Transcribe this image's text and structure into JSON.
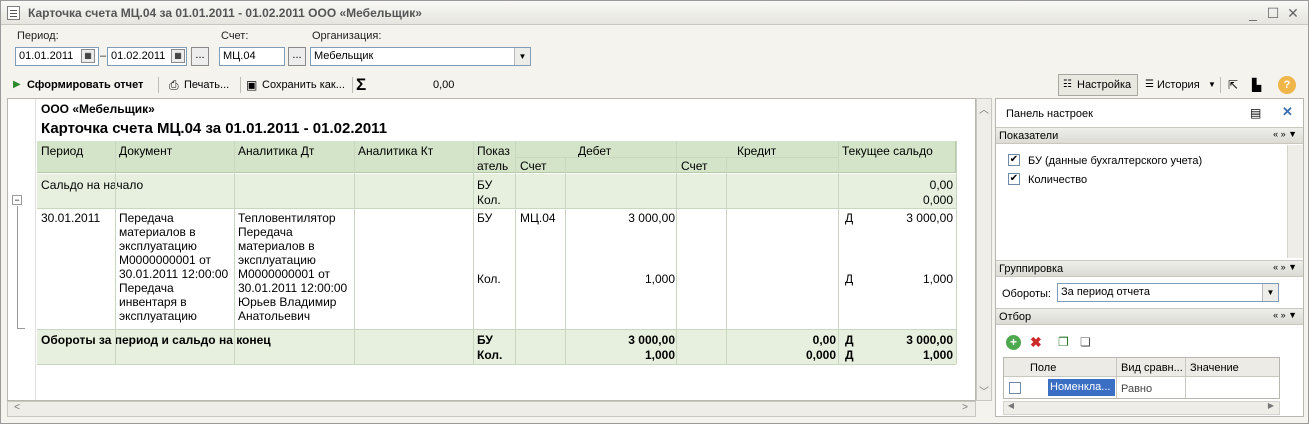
{
  "window": {
    "title": "Карточка счета МЦ.04 за 01.01.2011 - 01.02.2011 ООО «Мебельщик»"
  },
  "filters": {
    "period_label": "Период:",
    "date_from": "01.01.2011",
    "date_sep": "–",
    "date_to": "01.02.2011",
    "dots": "...",
    "account_label": "Счет:",
    "account": "МЦ.04",
    "org_label": "Организация:",
    "org": "Мебельщик"
  },
  "toolbar": {
    "generate": "Сформировать отчет",
    "print": "Печать...",
    "save": "Сохранить как...",
    "sigma": "Σ",
    "sum_value": "0,00",
    "settings": "Настройка",
    "history": "История"
  },
  "report": {
    "org": "ООО «Мебельщик»",
    "title": "Карточка счета МЦ.04 за 01.01.2011 - 01.02.2011",
    "headers": {
      "period": "Период",
      "document": "Документ",
      "analytics_dt": "Аналитика Дт",
      "analytics_kt": "Аналитика Кт",
      "indicator_1": "Показ",
      "indicator_2": "атель",
      "debit": "Дебет",
      "credit": "Кредит",
      "balance": "Текущее сальдо",
      "account": "Счет",
      "account_kt": "Счет"
    },
    "opening": {
      "label": "Сальдо на начало",
      "ind_bu": "БУ",
      "ind_qty": "Кол.",
      "balance_bu": "0,00",
      "balance_qty": "0,000"
    },
    "row": {
      "date": "30.01.2011",
      "document": [
        "Передача",
        "материалов в",
        "эксплуатацию",
        "М0000000001 от",
        "30.01.2011 12:00:00",
        "Передача",
        "инвентаря в",
        "эксплуатацию"
      ],
      "analytics_dt": [
        "Тепловентилятор",
        "Передача",
        "материалов в",
        "эксплуатацию",
        "М0000000001 от",
        "30.01.2011 12:00:00",
        "Юрьев Владимир",
        "Анатольевич"
      ],
      "ind_bu": "БУ",
      "ind_qty": "Кол.",
      "debit_account": "МЦ.04",
      "debit_bu": "3 000,00",
      "debit_qty": "1,000",
      "bal_side_bu": "Д",
      "balance_bu": "3 000,00",
      "bal_side_qty": "Д",
      "balance_qty": "1,000"
    },
    "totals": {
      "label": "Обороты за период и сальдо на конец",
      "ind_bu": "БУ",
      "ind_qty": "Кол.",
      "debit_bu": "3 000,00",
      "debit_qty": "1,000",
      "credit_bu": "0,00",
      "credit_qty": "0,000",
      "side_bu": "Д",
      "balance_bu": "3 000,00",
      "side_qty": "Д",
      "balance_qty": "1,000"
    }
  },
  "settings_panel": {
    "title": "Панель настроек",
    "indicators_title": "Показатели",
    "indicators": [
      {
        "label": "БУ (данные бухгалтерского учета)",
        "checked": true
      },
      {
        "label": "Количество",
        "checked": true
      }
    ],
    "grouping_title": "Группировка",
    "turnovers_label": "Обороты:",
    "turnovers_value": "За период отчета",
    "filter_title": "Отбор",
    "filter_columns": {
      "field": "Поле",
      "compare": "Вид сравн...",
      "value": "Значение"
    },
    "filter_row": {
      "field": "Номенкла...",
      "compare": "Равно",
      "value": ""
    }
  }
}
